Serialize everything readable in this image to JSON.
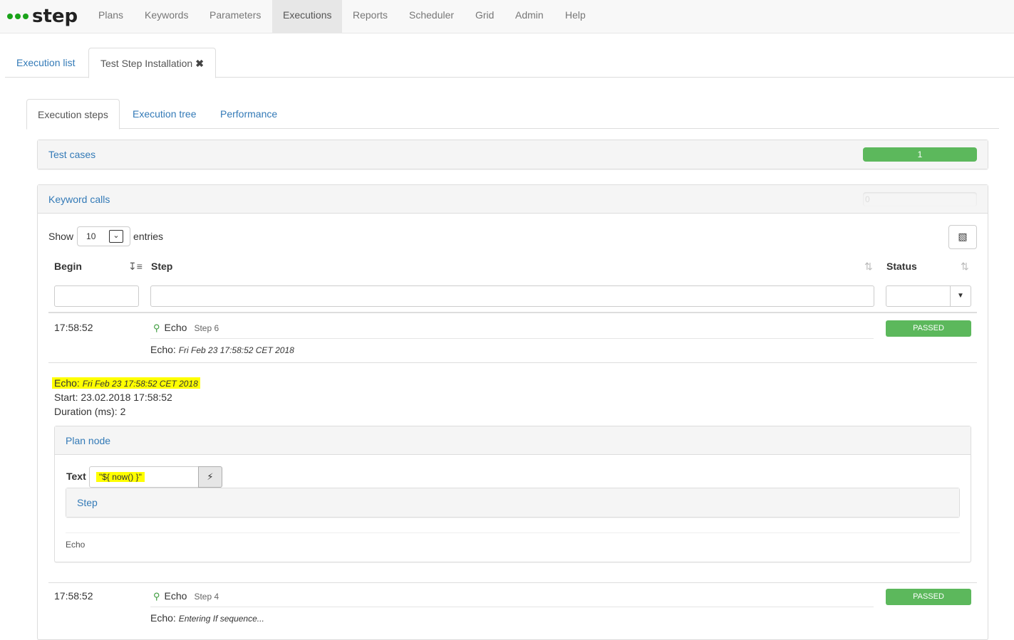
{
  "brand": {
    "name": "step"
  },
  "nav": {
    "items": [
      {
        "label": "Plans"
      },
      {
        "label": "Keywords"
      },
      {
        "label": "Parameters"
      },
      {
        "label": "Executions"
      },
      {
        "label": "Reports"
      },
      {
        "label": "Scheduler"
      },
      {
        "label": "Grid"
      },
      {
        "label": "Admin"
      },
      {
        "label": "Help"
      }
    ],
    "active": "Executions"
  },
  "tabs": {
    "execution_list": "Execution list",
    "current": "Test Step Installation",
    "close_icon": "✖"
  },
  "subtabs": {
    "steps": "Execution steps",
    "tree": "Execution tree",
    "performance": "Performance"
  },
  "test_cases": {
    "title": "Test cases",
    "count": "1",
    "progress": 1.0
  },
  "keyword_calls": {
    "title": "Keyword calls",
    "count": "0",
    "progress": 0.0
  },
  "table": {
    "show_label": "Show",
    "entries_value": "10",
    "entries_label": "entries",
    "headers": {
      "begin": "Begin",
      "step": "Step",
      "status": "Status"
    }
  },
  "rows": [
    {
      "begin": "17:58:52",
      "step": "Echo",
      "step_num": "Step 6",
      "output_label": "Echo:",
      "output_value": "Fri Feb 23 17:58:52 CET 2018",
      "status": "PASSED"
    },
    {
      "begin": "17:58:52",
      "step": "Echo",
      "step_num": "Step 4",
      "output_label": "Echo:",
      "output_value": "Entering If sequence...",
      "status": "PASSED"
    }
  ],
  "details": {
    "echo_label": "Echo:",
    "echo_value": "Fri Feb 23 17:58:52 CET 2018",
    "start": "Start: 23.02.2018 17:58:52",
    "duration": "Duration (ms): 2",
    "plan_node": {
      "title": "Plan node",
      "text_label": "Text",
      "text_value": "\"${ now() }\"",
      "step_title": "Step",
      "footer": "Echo"
    }
  },
  "colors": {
    "accent": "#337ab7",
    "success": "#5cb85c",
    "highlight": "#ffff00"
  }
}
